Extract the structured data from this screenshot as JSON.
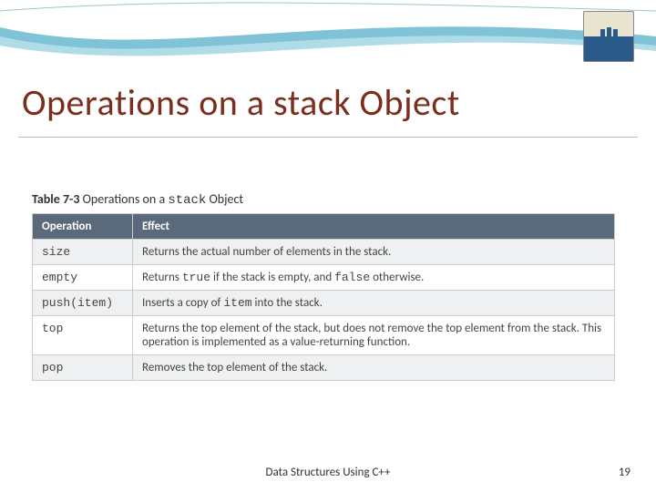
{
  "slide": {
    "title": "Operations on a stack Object",
    "table_label_prefix": "Table 7-3",
    "table_label_rest": "  Operations on a ",
    "table_label_code": "stack",
    "table_label_suffix": " Object",
    "header_operation": "Operation",
    "header_effect": "Effect",
    "rows": [
      {
        "op": "size",
        "effect": "Returns the actual number of elements in the stack."
      },
      {
        "op": "empty",
        "effect_pre": "Returns ",
        "code1": "true",
        "mid": " if the stack is empty, and ",
        "code2": "false",
        "post": " otherwise."
      },
      {
        "op": "push(item)",
        "effect_pre": "Inserts a copy of ",
        "code1": "item",
        "post": " into the stack."
      },
      {
        "op": "top",
        "effect": "Returns the top element of the stack, but does not remove the top element from the stack. This operation is implemented as a value-returning function."
      },
      {
        "op": "pop",
        "effect": "Removes the top element of the stack."
      }
    ],
    "footer": "Data Structures Using C++",
    "page": "19"
  }
}
